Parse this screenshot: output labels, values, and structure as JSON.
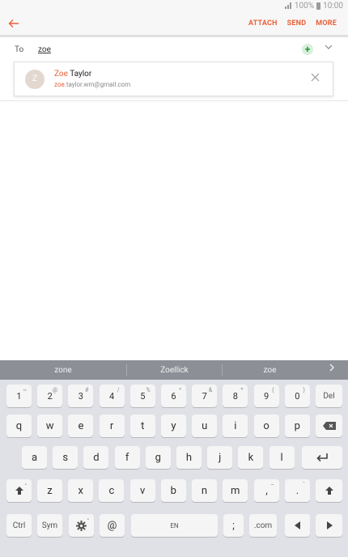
{
  "status_bar": {
    "text": "100% ▉ 10:00",
    "battery": "100%",
    "time": "10:00"
  },
  "app_bar": {
    "attach": "ATTACH",
    "send": "SEND",
    "more": "MORE"
  },
  "to_row": {
    "label": "To",
    "value": "zoe"
  },
  "suggestion": {
    "avatar_letter": "Z",
    "name_match": "Zoe",
    "name_rest": " Taylor",
    "email_match": "zoe",
    "email_rest": ".taylor.wm@gmail.com"
  },
  "keyboard": {
    "predictions": [
      "zone",
      "Zoellick",
      "zoe"
    ],
    "row1": [
      {
        "k": "1",
        "s": "~"
      },
      {
        "k": "2",
        "s": "@"
      },
      {
        "k": "3",
        "s": "#"
      },
      {
        "k": "4",
        "s": "/"
      },
      {
        "k": "5",
        "s": "%"
      },
      {
        "k": "6",
        "s": "^"
      },
      {
        "k": "7",
        "s": "&"
      },
      {
        "k": "8",
        "s": "*"
      },
      {
        "k": "9",
        "s": "("
      },
      {
        "k": "0",
        "s": ")"
      }
    ],
    "row1_del": "Del",
    "row2": [
      "q",
      "w",
      "e",
      "r",
      "t",
      "y",
      "u",
      "i",
      "o",
      "p"
    ],
    "row3": [
      "a",
      "s",
      "d",
      "f",
      "g",
      "h",
      "j",
      "k",
      "l"
    ],
    "row4": [
      "z",
      "x",
      "c",
      "v",
      "b",
      "n",
      "m"
    ],
    "row4_comma": ",",
    "row4_comma_sup": "–",
    "row4_period": ".",
    "row4_period_sup": "¯",
    "row5": {
      "ctrl": "Ctrl",
      "sym": "Sym",
      "at": "@",
      "space": "EN",
      "semicolon": ";",
      "com": ".com"
    }
  },
  "colors": {
    "accent": "#e8613a",
    "keyboard_bg": "#dfe1e6",
    "prediction_bg": "#8c8f96"
  }
}
